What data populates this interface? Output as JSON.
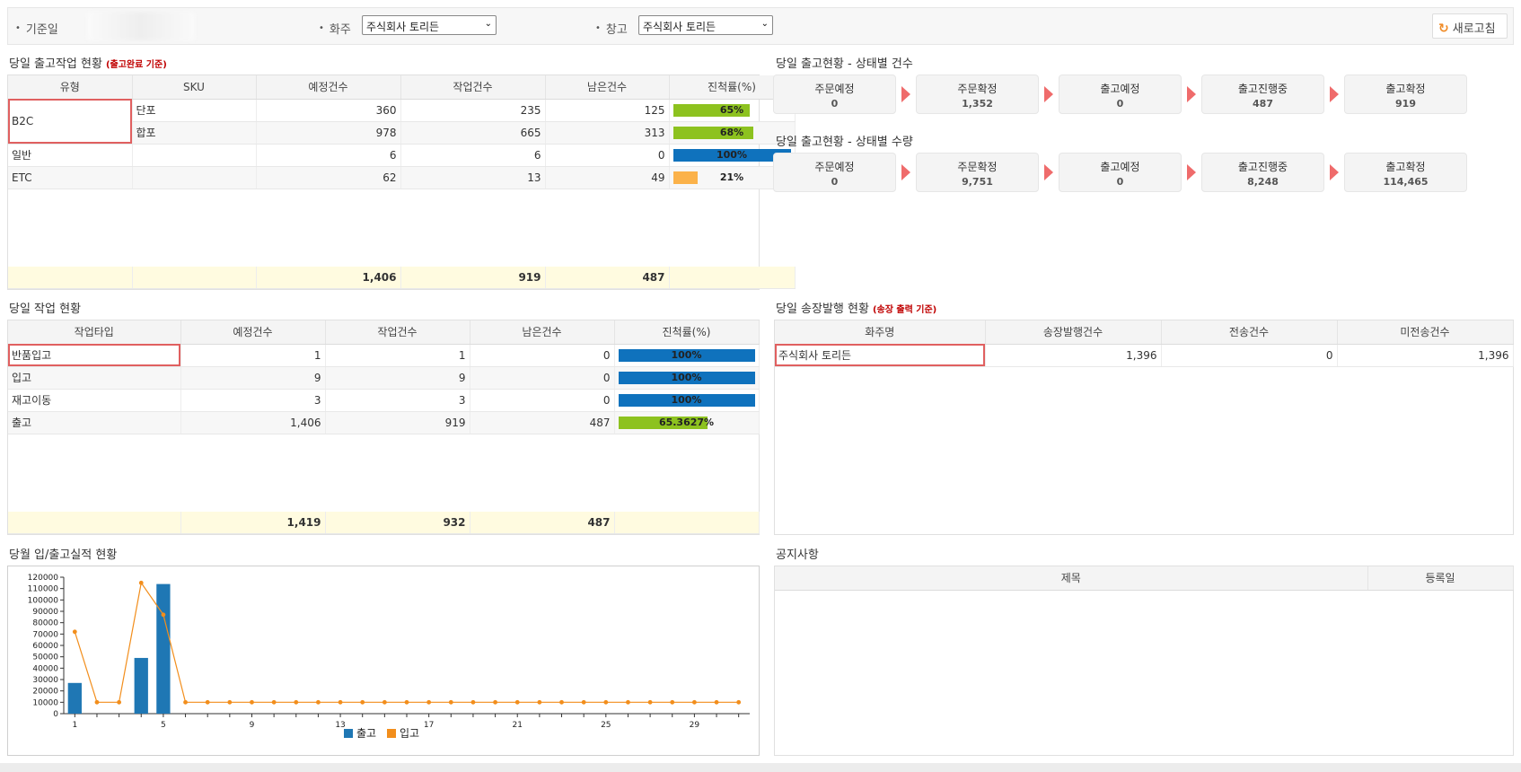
{
  "filters": {
    "date_label": "기준일",
    "owner_label": "화주",
    "owner_value": "주식회사 토리든",
    "warehouse_label": "창고",
    "warehouse_value": "주식회사 토리든",
    "refresh_label": "새로고침"
  },
  "outbound": {
    "title": "당일 출고작업 현황",
    "note": "(출고완료 기준)",
    "headers": [
      "유형",
      "SKU",
      "예정건수",
      "작업건수",
      "남은건수",
      "진척률(%)"
    ],
    "group_b2c": "B2C",
    "rows": [
      {
        "sku": "단포",
        "planned": "360",
        "done": "235",
        "remain": "125",
        "progress": 65,
        "progress_label": "65%",
        "color": "#8dc21f"
      },
      {
        "sku": "합포",
        "planned": "978",
        "done": "665",
        "remain": "313",
        "progress": 68,
        "progress_label": "68%",
        "color": "#8dc21f"
      },
      {
        "type": "일반",
        "sku": "",
        "planned": "6",
        "done": "6",
        "remain": "0",
        "progress": 100,
        "progress_label": "100%",
        "color": "#0f72bd"
      },
      {
        "type": "ETC",
        "sku": "",
        "planned": "62",
        "done": "13",
        "remain": "49",
        "progress": 21,
        "progress_label": "21%",
        "color": "#fbb24a"
      }
    ],
    "totals": {
      "planned": "1,406",
      "done": "919",
      "remain": "487"
    }
  },
  "status_count": {
    "title": "당일 출고현황 - 상태별 건수",
    "items": [
      {
        "label": "주문예정",
        "value": "0"
      },
      {
        "label": "주문확정",
        "value": "1,352"
      },
      {
        "label": "출고예정",
        "value": "0"
      },
      {
        "label": "출고진행중",
        "value": "487"
      },
      {
        "label": "출고확정",
        "value": "919"
      }
    ]
  },
  "status_qty": {
    "title": "당일 출고현황 - 상태별 수량",
    "items": [
      {
        "label": "주문예정",
        "value": "0"
      },
      {
        "label": "주문확정",
        "value": "9,751"
      },
      {
        "label": "출고예정",
        "value": "0"
      },
      {
        "label": "출고진행중",
        "value": "8,248"
      },
      {
        "label": "출고확정",
        "value": "114,465"
      }
    ]
  },
  "work": {
    "title": "당일 작업 현황",
    "headers": [
      "작업타입",
      "예정건수",
      "작업건수",
      "남은건수",
      "진척률(%)"
    ],
    "rows": [
      {
        "type": "반품입고",
        "planned": "1",
        "done": "1",
        "remain": "0",
        "progress": 100,
        "progress_label": "100%",
        "color": "#0f72bd"
      },
      {
        "type": "입고",
        "planned": "9",
        "done": "9",
        "remain": "0",
        "progress": 100,
        "progress_label": "100%",
        "color": "#0f72bd"
      },
      {
        "type": "재고이동",
        "planned": "3",
        "done": "3",
        "remain": "0",
        "progress": 100,
        "progress_label": "100%",
        "color": "#0f72bd"
      },
      {
        "type": "출고",
        "planned": "1,406",
        "done": "919",
        "remain": "487",
        "progress": 65.3627,
        "progress_label": "65.3627%",
        "color": "#8dc21f"
      }
    ],
    "totals": {
      "planned": "1,419",
      "done": "932",
      "remain": "487"
    }
  },
  "invoice": {
    "title": "당일 송장발행 현황",
    "note": "(송장 출력 기준)",
    "headers": [
      "화주명",
      "송장발행건수",
      "전송건수",
      "미전송건수"
    ],
    "rows": [
      {
        "owner": "주식회사 토리든",
        "issued": "1,396",
        "sent": "0",
        "unsent": "1,396"
      }
    ]
  },
  "chart": {
    "title": "당월 입/출고실적 현황"
  },
  "notice": {
    "title": "공지사항",
    "headers": [
      "제목",
      "등록일"
    ]
  },
  "chart_data": {
    "type": "bar",
    "x": [
      1,
      2,
      3,
      4,
      5,
      6,
      7,
      8,
      9,
      10,
      11,
      12,
      13,
      14,
      15,
      16,
      17,
      18,
      19,
      20,
      21,
      22,
      23,
      24,
      25,
      26,
      27,
      28,
      29,
      30,
      31
    ],
    "xticks": [
      "1",
      "5",
      "9",
      "13",
      "17",
      "21",
      "25",
      "29"
    ],
    "ylim": [
      0,
      120000
    ],
    "yticks": [
      0,
      10000,
      20000,
      30000,
      40000,
      50000,
      60000,
      70000,
      80000,
      90000,
      100000,
      110000,
      120000
    ],
    "series": [
      {
        "name": "출고",
        "type": "bar",
        "color": "#1f77b4",
        "values": [
          27000,
          0,
          0,
          49000,
          114000,
          0,
          0,
          0,
          0,
          0,
          0,
          0,
          0,
          0,
          0,
          0,
          0,
          0,
          0,
          0,
          0,
          0,
          0,
          0,
          0,
          0,
          0,
          0,
          0,
          0,
          0
        ]
      },
      {
        "name": "입고",
        "type": "line",
        "color": "#f28e1c",
        "values": [
          72000,
          10000,
          10000,
          115000,
          87000,
          10000,
          10000,
          10000,
          10000,
          10000,
          10000,
          10000,
          10000,
          10000,
          10000,
          10000,
          10000,
          10000,
          10000,
          10000,
          10000,
          10000,
          10000,
          10000,
          10000,
          10000,
          10000,
          10000,
          10000,
          10000,
          10000
        ]
      }
    ],
    "legend": "bottom-center"
  }
}
